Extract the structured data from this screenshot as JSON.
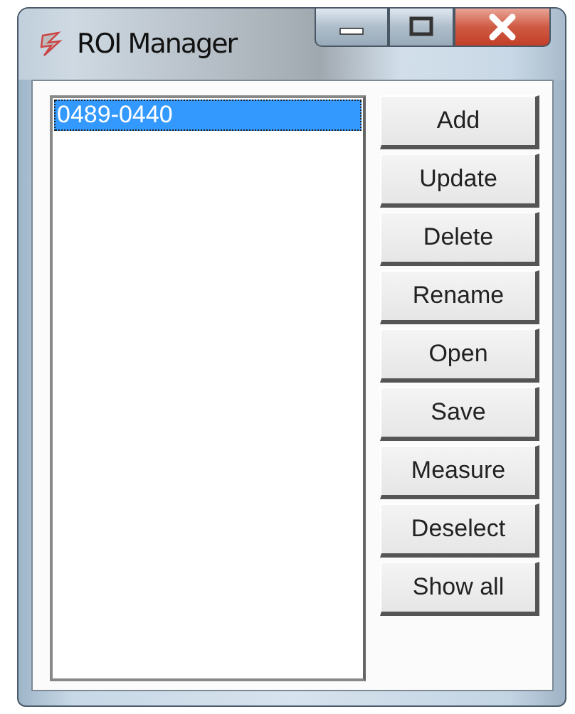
{
  "window": {
    "title": "ROI Manager"
  },
  "roi_list": {
    "items": [
      {
        "label": "0489-0440",
        "selected": true
      }
    ]
  },
  "buttons": [
    "Add",
    "Update",
    "Delete",
    "Rename",
    "Open",
    "Save",
    "Measure",
    "Deselect",
    "Show all"
  ]
}
